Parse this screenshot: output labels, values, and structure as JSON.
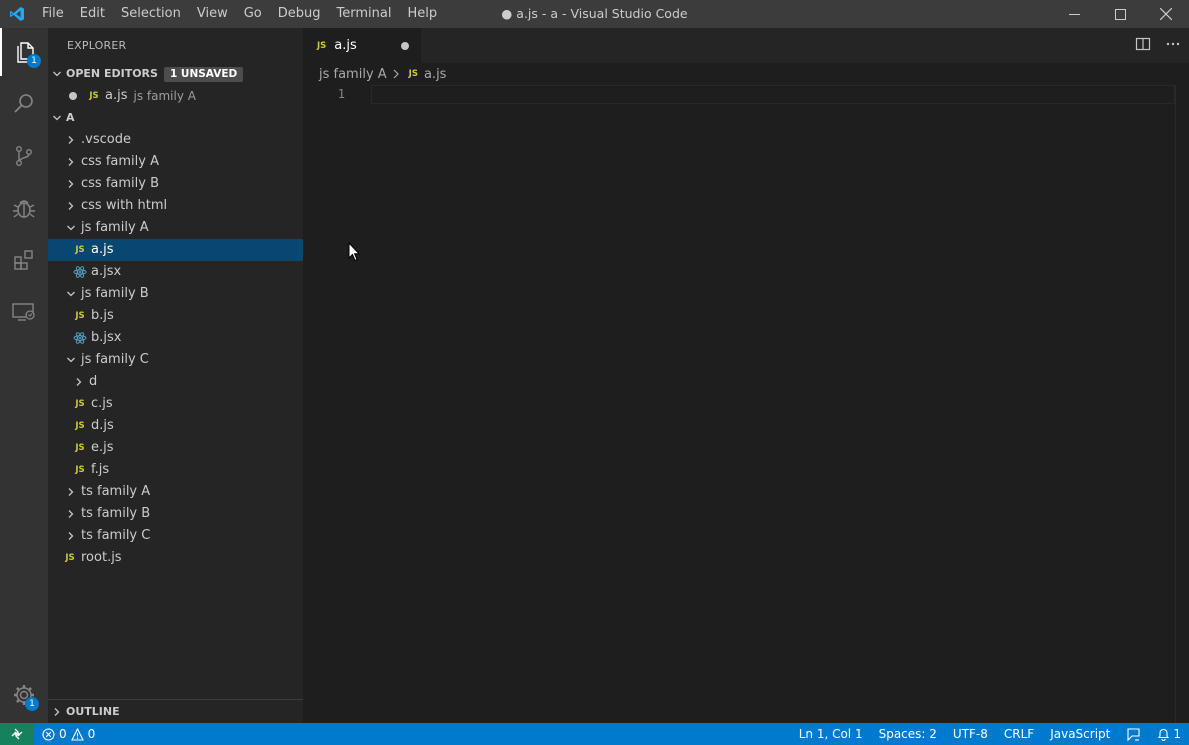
{
  "window": {
    "title": "● a.js - a - Visual Studio Code",
    "menu": [
      "File",
      "Edit",
      "Selection",
      "View",
      "Go",
      "Debug",
      "Terminal",
      "Help"
    ]
  },
  "activity": {
    "explorer_badge": "1",
    "settings_badge": "1"
  },
  "explorer": {
    "title": "EXPLORER",
    "open_editors": {
      "header": "OPEN EDITORS",
      "unsaved_badge": "1 UNSAVED",
      "items": [
        {
          "icon": "JS",
          "name": "a.js",
          "description": "js family A"
        }
      ]
    },
    "folder": {
      "header": "A",
      "tree": [
        {
          "type": "folder",
          "name": ".vscode",
          "expanded": false,
          "depth": 0
        },
        {
          "type": "folder",
          "name": "css family A",
          "expanded": false,
          "depth": 0
        },
        {
          "type": "folder",
          "name": "css family B",
          "expanded": false,
          "depth": 0
        },
        {
          "type": "folder",
          "name": "css with html",
          "expanded": false,
          "depth": 0
        },
        {
          "type": "folder",
          "name": "js family A",
          "expanded": true,
          "depth": 0
        },
        {
          "type": "js",
          "name": "a.js",
          "depth": 1,
          "selected": true
        },
        {
          "type": "jsx",
          "name": "a.jsx",
          "depth": 1
        },
        {
          "type": "folder",
          "name": "js family B",
          "expanded": true,
          "depth": 0
        },
        {
          "type": "js",
          "name": "b.js",
          "depth": 1
        },
        {
          "type": "jsx",
          "name": "b.jsx",
          "depth": 1
        },
        {
          "type": "folder",
          "name": "js family C",
          "expanded": true,
          "depth": 0
        },
        {
          "type": "folder",
          "name": "d",
          "expanded": false,
          "depth": 1
        },
        {
          "type": "js",
          "name": "c.js",
          "depth": 1
        },
        {
          "type": "js",
          "name": "d.js",
          "depth": 1
        },
        {
          "type": "js",
          "name": "e.js",
          "depth": 1
        },
        {
          "type": "js",
          "name": "f.js",
          "depth": 1
        },
        {
          "type": "folder",
          "name": "ts family A",
          "expanded": false,
          "depth": 0
        },
        {
          "type": "folder",
          "name": "ts family B",
          "expanded": false,
          "depth": 0
        },
        {
          "type": "folder",
          "name": "ts family C",
          "expanded": false,
          "depth": 0
        },
        {
          "type": "js",
          "name": "root.js",
          "depth": -1
        }
      ]
    },
    "outline": "OUTLINE"
  },
  "editor": {
    "tab": {
      "icon": "JS",
      "label": "a.js"
    },
    "breadcrumbs": {
      "folder": "js family A",
      "icon": "JS",
      "file": "a.js"
    },
    "line_number": "1"
  },
  "status": {
    "errors": "0",
    "warnings": "0",
    "position": "Ln 1, Col 1",
    "spaces": "Spaces: 2",
    "encoding": "UTF-8",
    "eol": "CRLF",
    "language": "JavaScript",
    "notifications": "1"
  },
  "colors": {
    "accent": "#007acc",
    "selection": "#094771",
    "js_icon": "#cbcb41",
    "jsx_icon": "#519aba",
    "remote": "#16825d"
  }
}
